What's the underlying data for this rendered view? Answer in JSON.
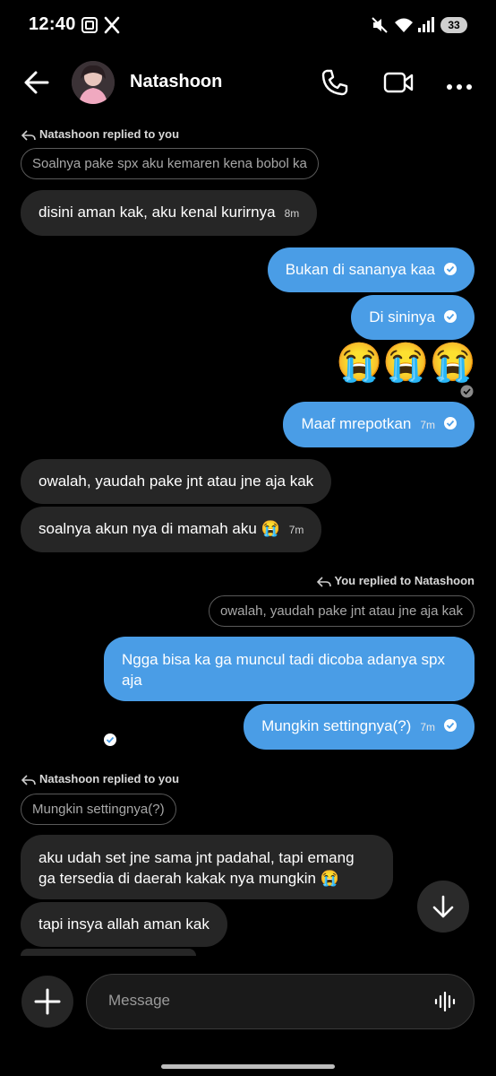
{
  "status_bar": {
    "time": "12:40",
    "battery": "33",
    "icons": [
      "screenshot-icon",
      "x-logo-icon",
      "mute-icon",
      "wifi-icon",
      "signal-icon",
      "battery-icon"
    ]
  },
  "header": {
    "contact_name": "Natashoon",
    "icons": [
      "back-arrow-icon",
      "phone-icon",
      "video-camera-icon",
      "more-icon"
    ]
  },
  "messages": {
    "m1": {
      "reply_note": "Natashoon replied to you",
      "quote": "Soalnya pake spx aku kemaren kena bobol ka",
      "text": "disini aman kak, aku kenal kurirnya",
      "time": "8m"
    },
    "m2": {
      "text": "Bukan di sananya kaa"
    },
    "m3": {
      "text": "Di sininya"
    },
    "m4": {
      "emoji": "😭😭😭"
    },
    "m5": {
      "text": "Maaf mrepotkan",
      "time": "7m"
    },
    "m6": {
      "text": "owalah, yaudah pake jnt atau jne aja kak"
    },
    "m7": {
      "text": "soalnya akun nya di mamah aku 😭",
      "time": "7m"
    },
    "m8": {
      "reply_note": "You replied to Natashoon",
      "quote": "owalah, yaudah pake jnt atau jne aja kak",
      "line1": "Ngga bisa ka ga muncul tadi dicoba adanya spx",
      "line2": "aja"
    },
    "m9": {
      "text": "Mungkin settingnya(?)",
      "time": "7m"
    },
    "m10": {
      "reply_note": "Natashoon replied to you",
      "quote": "Mungkin settingnya(?)",
      "line1": "aku udah set jne sama jnt padahal, tapi emang",
      "line2": "ga tersedia di daerah kakak nya mungkin 😭"
    },
    "m11": {
      "text": "tapi insya allah aman kak"
    }
  },
  "composer": {
    "placeholder": "Message",
    "icons": [
      "plus-icon",
      "voice-wave-icon",
      "scroll-down-arrow-icon"
    ]
  },
  "colors": {
    "outgoing_bubble": "#4a9de6",
    "incoming_bubble": "#262626",
    "background": "#000000"
  }
}
